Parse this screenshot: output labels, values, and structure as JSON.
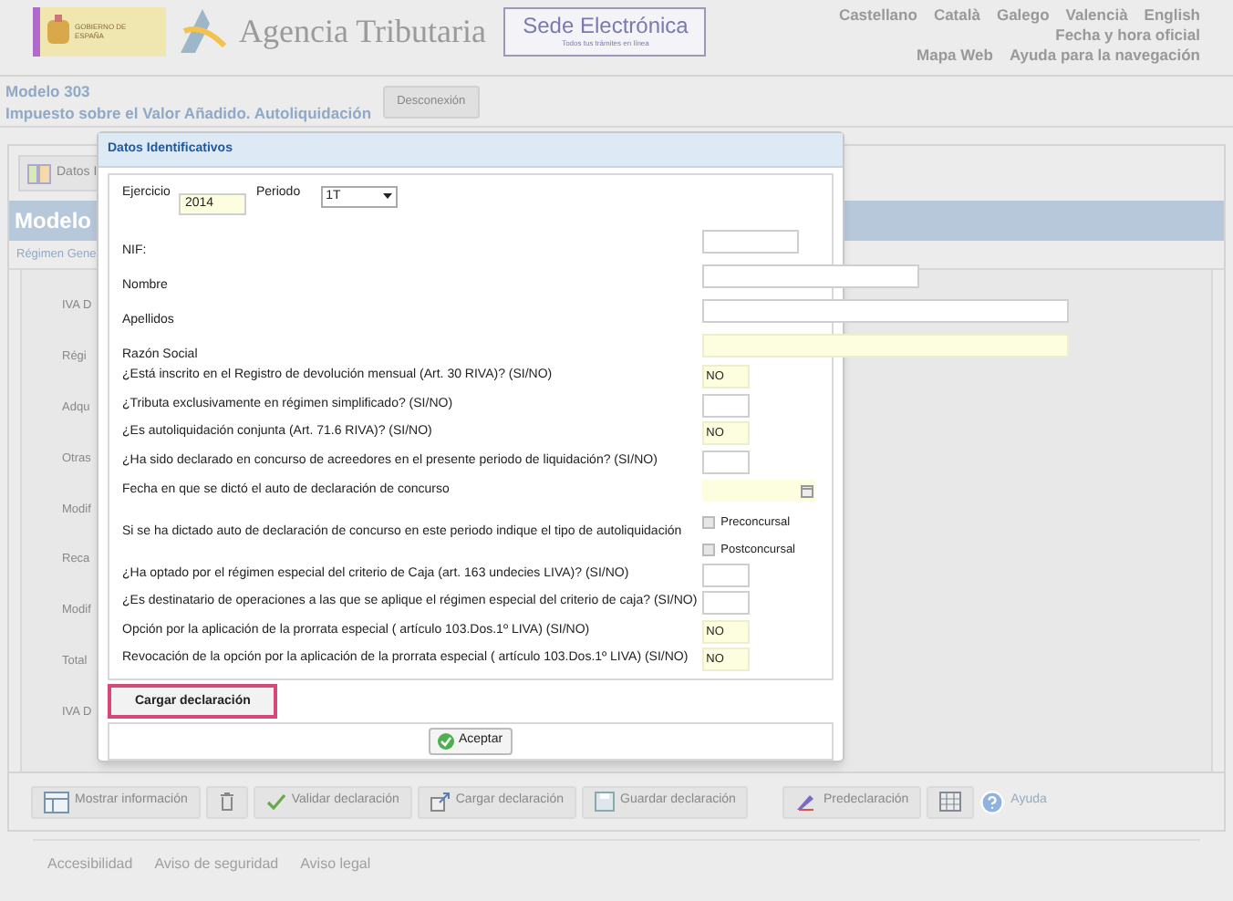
{
  "header": {
    "gov_logo_text": "GOBIERNO DE ESPAÑA",
    "agency": "Agencia Tributaria",
    "sede": {
      "title": "Sede Electrónica",
      "tagline": "Todos tus trámites en línea"
    },
    "languages": [
      "Castellano",
      "Català",
      "Galego",
      "Valencià",
      "English"
    ],
    "links_row_2": [
      "Fecha y hora oficial"
    ],
    "links_row_3": [
      "Mapa Web",
      "Ayuda para la navegación"
    ]
  },
  "model": {
    "title": "Modelo 303",
    "subtitle": "Impuesto sobre el Valor Añadido. Autoliquidación",
    "disconnect_button": "Desconexión"
  },
  "panel": {
    "toolbar_button": "Datos I",
    "heading": "Modelo",
    "tab": "Régimen Gene",
    "side_labels": [
      "IVA D",
      "Régi",
      "Adqu",
      "Otras",
      "Modif",
      "Reca",
      "Modif",
      "Total",
      "IVA D"
    ]
  },
  "bottom_toolbar": [
    {
      "kind": "info",
      "label": "Mostrar información"
    },
    {
      "kind": "delete"
    },
    {
      "kind": "validate",
      "label": "Validar declaración"
    },
    {
      "kind": "load",
      "label": "Cargar declaración"
    },
    {
      "kind": "save",
      "label": "Guardar declaración"
    },
    {
      "kind": "predeclaration",
      "label": "Predeclaración"
    },
    {
      "kind": "grid"
    },
    {
      "kind": "help",
      "label": "Ayuda"
    }
  ],
  "footer": [
    "Accesibilidad",
    "Aviso de seguridad",
    "Aviso legal"
  ],
  "dialog": {
    "title": "Datos Identificativos",
    "ejercicio": {
      "label": "Ejercicio",
      "value": "2014"
    },
    "periodo": {
      "label": "Periodo",
      "value": "1T"
    },
    "rows": [
      {
        "kind": "short",
        "label": "NIF:",
        "value": "",
        "required": false
      },
      {
        "kind": "medium",
        "label": "Nombre",
        "value": "",
        "required": false
      },
      {
        "kind": "long",
        "label": "Apellidos",
        "value": "",
        "required": false
      },
      {
        "kind": "long",
        "label": "Razón Social",
        "value": "",
        "required": true
      },
      {
        "kind": "yesno",
        "label": "¿Está inscrito en el Registro de devolución mensual (Art. 30 RIVA)? (SI/NO)",
        "value": "NO",
        "required": true
      },
      {
        "kind": "yesno",
        "label": "¿Tributa exclusivamente en régimen simplificado? (SI/NO)",
        "value": "",
        "required": false
      },
      {
        "kind": "yesno",
        "label": "¿Es autoliquidación conjunta (Art. 71.6 RIVA)? (SI/NO)",
        "value": "NO",
        "required": true
      },
      {
        "kind": "yesno",
        "label": "¿Ha sido declarado en concurso de acreedores en el presente periodo de liquidación? (SI/NO)",
        "value": "",
        "required": false
      },
      {
        "kind": "date",
        "label": "Fecha en que se dictó el auto de declaración de concurso",
        "value": "",
        "required": true
      },
      {
        "kind": "checks",
        "label": "Si se ha dictado auto de declaración de concurso en este periodo indique el tipo de autoliquidación",
        "options": [
          {
            "label": "Preconcursal",
            "checked": false
          },
          {
            "label": "Postconcursal",
            "checked": false
          }
        ]
      },
      {
        "kind": "yesno",
        "label": "¿Ha optado por el régimen especial del criterio de Caja (art. 163 undecies LIVA)? (SI/NO)",
        "value": "",
        "required": false
      },
      {
        "kind": "yesno",
        "label": "¿Es destinatario de operaciones a las que se aplique el régimen especial del criterio de caja? (SI/NO)",
        "value": "",
        "required": false
      },
      {
        "kind": "yesno",
        "label": "Opción por la aplicación de la prorrata especial ( artículo 103.Dos.1º LIVA) (SI/NO)",
        "value": "NO",
        "required": true
      },
      {
        "kind": "yesno",
        "label": "Revocación de la opción por la aplicación de la prorrata especial ( artículo 103.Dos.1º LIVA) (SI/NO)",
        "value": "NO",
        "required": true
      }
    ],
    "load_button": "Cargar declaración",
    "accept_button": "Aceptar"
  }
}
